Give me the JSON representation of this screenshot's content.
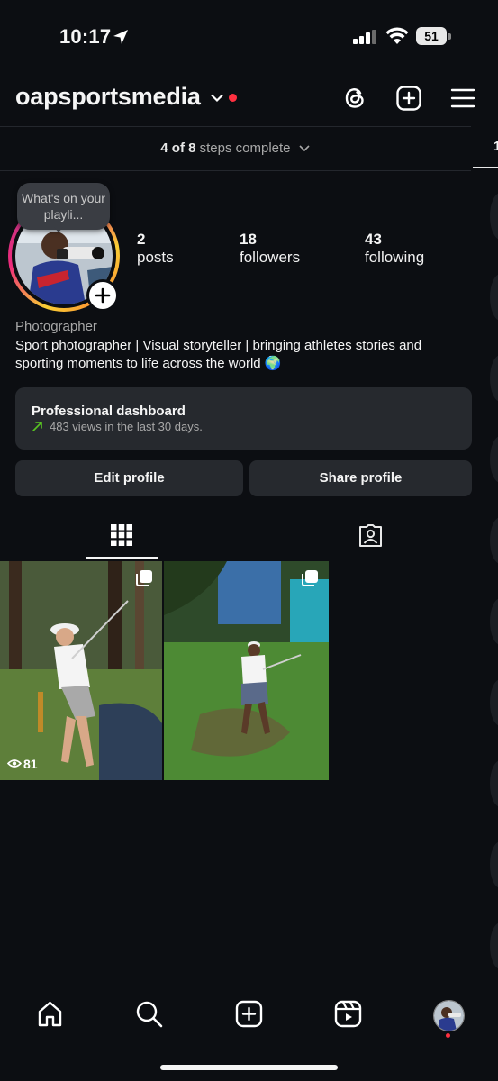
{
  "status_bar": {
    "time": "10:17",
    "battery": "51"
  },
  "header": {
    "username": "oapsportsmedia"
  },
  "steps": {
    "done": "4 of 8",
    "rest": "steps complete"
  },
  "peek_tab": {
    "label": "1"
  },
  "profile": {
    "bubble": "What's on your playli...",
    "stats": [
      {
        "value": "2",
        "label": "posts"
      },
      {
        "value": "18",
        "label": "followers"
      },
      {
        "value": "43",
        "label": "following"
      }
    ],
    "category": "Photographer",
    "bio": "Sport photographer | Visual storyteller | bringing athletes stories and sporting moments to life across the world 🌍"
  },
  "dashboard": {
    "title": "Professional dashboard",
    "subtitle": "483 views in the last 30 days."
  },
  "buttons": {
    "edit": "Edit profile",
    "share": "Share profile"
  },
  "posts": [
    {
      "views": "81"
    },
    {
      "views": ""
    }
  ],
  "colors": {
    "background": "#0c0e12",
    "card": "#26292e",
    "notification": "#ff3040",
    "trend": "#58c322"
  },
  "icons": [
    "location-arrow-icon",
    "signal-icon",
    "wifi-icon",
    "chevron-down-icon",
    "threads-icon",
    "new-post-icon",
    "menu-icon",
    "grid-icon",
    "tagged-icon",
    "eye-icon",
    "multiple-photos-icon",
    "home-icon",
    "search-icon",
    "create-icon",
    "reels-icon"
  ]
}
